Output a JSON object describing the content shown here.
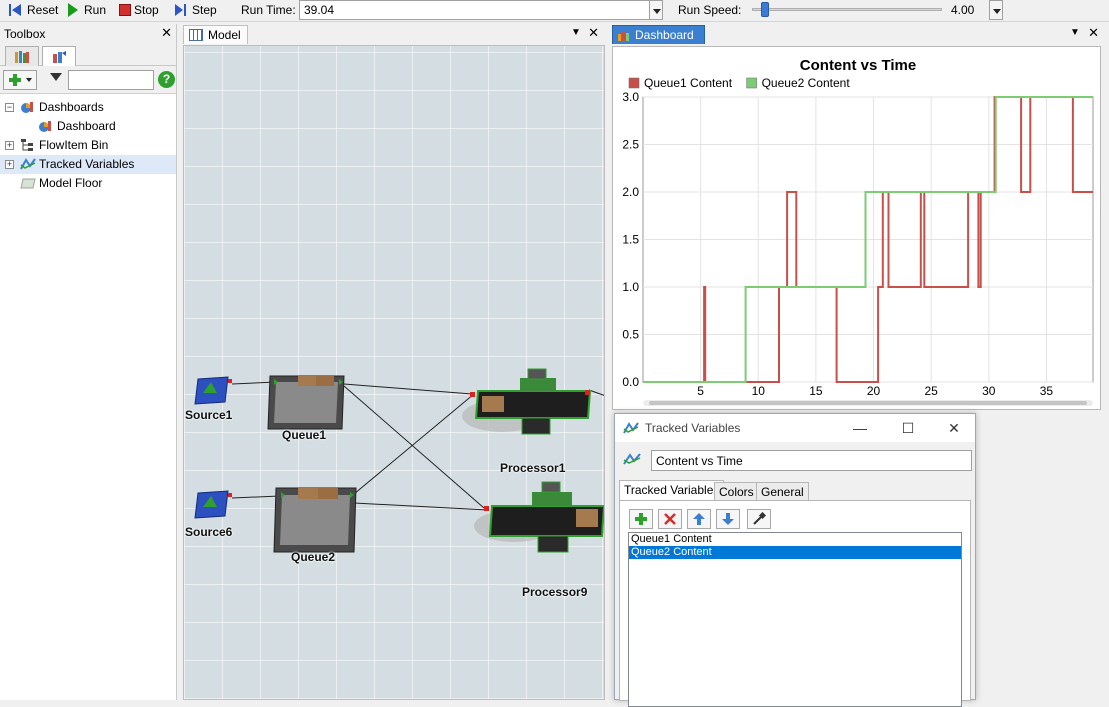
{
  "toolbar": {
    "reset_label": "Reset",
    "run_label": "Run",
    "stop_label": "Stop",
    "step_label": "Step",
    "run_time_label": "Run Time:",
    "run_time_value": "39.04",
    "run_speed_label": "Run Speed:",
    "run_speed_value": "4.00",
    "run_speed_fraction": 0.05
  },
  "toolbox": {
    "title": "Toolbox",
    "tree": [
      {
        "label": "Dashboards",
        "expander": "−"
      },
      {
        "label": "Dashboard",
        "expander": ""
      },
      {
        "label": "FlowItem Bin",
        "expander": "+"
      },
      {
        "label": "Tracked Variables",
        "expander": "+"
      },
      {
        "label": "Model Floor",
        "expander": ""
      }
    ]
  },
  "model": {
    "tab_label": "Model",
    "objects": {
      "source1": "Source1",
      "source6": "Source6",
      "queue1": "Queue1",
      "queue2": "Queue2",
      "processor1": "Processor1",
      "processor9": "Processor9"
    }
  },
  "dashboard": {
    "tab_label": "Dashboard"
  },
  "chart_data": {
    "type": "line",
    "title": "Content vs Time",
    "xlabel": "",
    "ylabel": "",
    "xlim": [
      0,
      39.04
    ],
    "ylim": [
      0,
      3
    ],
    "x_ticks": [
      5,
      10,
      15,
      20,
      25,
      30,
      35
    ],
    "y_ticks": [
      0.0,
      0.5,
      1.0,
      1.5,
      2.0,
      2.5,
      3.0
    ],
    "grid": true,
    "legend": "top-left",
    "step": true,
    "series": [
      {
        "name": "Queue1 Content",
        "color": "#c8504b",
        "points": [
          [
            0,
            0
          ],
          [
            5.3,
            0
          ],
          [
            5.3,
            1
          ],
          [
            5.4,
            1
          ],
          [
            5.4,
            0
          ],
          [
            11.8,
            0
          ],
          [
            11.8,
            1
          ],
          [
            12.5,
            1
          ],
          [
            12.5,
            2
          ],
          [
            13.3,
            2
          ],
          [
            13.3,
            1
          ],
          [
            16.8,
            1
          ],
          [
            16.8,
            0
          ],
          [
            20.4,
            0
          ],
          [
            20.4,
            1
          ],
          [
            20.8,
            1
          ],
          [
            20.8,
            2
          ],
          [
            21.3,
            2
          ],
          [
            21.3,
            1
          ],
          [
            24.1,
            1
          ],
          [
            24.1,
            2
          ],
          [
            24.4,
            2
          ],
          [
            24.4,
            1
          ],
          [
            28.2,
            1
          ],
          [
            28.2,
            2
          ],
          [
            29.1,
            2
          ],
          [
            29.1,
            1
          ],
          [
            29.3,
            1
          ],
          [
            29.3,
            2
          ],
          [
            30.5,
            2
          ],
          [
            30.5,
            3
          ],
          [
            32.8,
            3
          ],
          [
            32.8,
            2
          ],
          [
            33.6,
            2
          ],
          [
            33.6,
            3
          ],
          [
            37.3,
            3
          ],
          [
            37.3,
            2
          ],
          [
            39.04,
            2
          ]
        ]
      },
      {
        "name": "Queue2 Content",
        "color": "#7dcb73",
        "points": [
          [
            0,
            0
          ],
          [
            8.9,
            0
          ],
          [
            8.9,
            1
          ],
          [
            19.3,
            1
          ],
          [
            19.3,
            2
          ],
          [
            30.6,
            2
          ],
          [
            30.6,
            3
          ],
          [
            39.04,
            3
          ]
        ]
      }
    ]
  },
  "tracked_variables_window": {
    "title": "Tracked Variables",
    "name_value": "Content vs Time",
    "tabs": [
      "Tracked Variables",
      "Colors",
      "General"
    ],
    "list_items": [
      "Queue1 Content",
      "Queue2 Content"
    ],
    "selected_index": 1
  }
}
